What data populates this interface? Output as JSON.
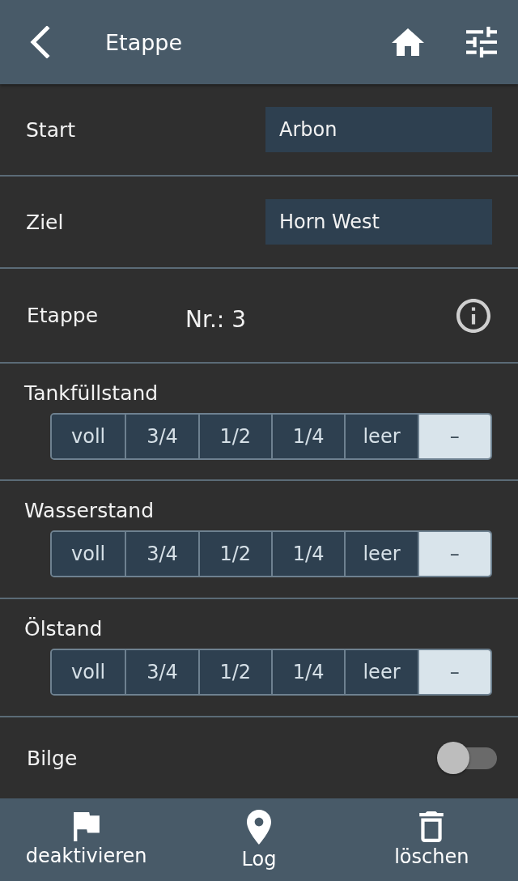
{
  "header": {
    "title": "Etappe"
  },
  "fields": [
    {
      "label": "Start",
      "value": "Arbon"
    },
    {
      "label": "Ziel",
      "value": "Horn West"
    }
  ],
  "stage": {
    "label": "Etappe",
    "number": "Nr.: 3"
  },
  "levels": [
    {
      "label": "Tankfüllstand",
      "options": [
        {
          "label": "voll",
          "selected": false
        },
        {
          "label": "3/4",
          "selected": false
        },
        {
          "label": "1/2",
          "selected": false
        },
        {
          "label": "1/4",
          "selected": false
        },
        {
          "label": "leer",
          "selected": false
        },
        {
          "label": "–",
          "selected": true
        }
      ]
    },
    {
      "label": "Wasserstand",
      "options": [
        {
          "label": "voll",
          "selected": false
        },
        {
          "label": "3/4",
          "selected": false
        },
        {
          "label": "1/2",
          "selected": false
        },
        {
          "label": "1/4",
          "selected": false
        },
        {
          "label": "leer",
          "selected": false
        },
        {
          "label": "–",
          "selected": true
        }
      ]
    },
    {
      "label": "Ölstand",
      "options": [
        {
          "label": "voll",
          "selected": false
        },
        {
          "label": "3/4",
          "selected": false
        },
        {
          "label": "1/2",
          "selected": false
        },
        {
          "label": "1/4",
          "selected": false
        },
        {
          "label": "leer",
          "selected": false
        },
        {
          "label": "–",
          "selected": true
        }
      ]
    }
  ],
  "bilge": {
    "label": "Bilge",
    "on": false
  },
  "footer": [
    {
      "label": "deaktivieren",
      "kind": "flag"
    },
    {
      "label": "Log",
      "kind": "pin"
    },
    {
      "label": "löschen",
      "kind": "trash"
    }
  ]
}
